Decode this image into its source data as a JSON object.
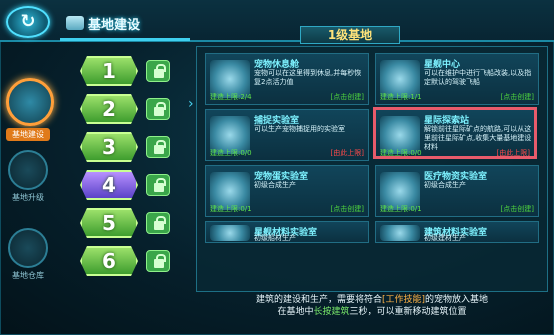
{
  "header": {
    "back_icon": "back-arrow-icon",
    "title": "基地建设",
    "level_tab": "1级基地"
  },
  "categories": [
    {
      "label": "基地建设",
      "icon": "base-building-icon",
      "active": true
    },
    {
      "label": "基地升级",
      "icon": "base-upgrade-icon",
      "active": false
    },
    {
      "label": "基地仓库",
      "icon": "warehouse-box-icon",
      "active": false
    }
  ],
  "levels": [
    {
      "num": "1",
      "color": "green"
    },
    {
      "num": "2",
      "color": "green"
    },
    {
      "num": "3",
      "color": "green"
    },
    {
      "num": "4",
      "color": "purple"
    },
    {
      "num": "5",
      "color": "green"
    },
    {
      "num": "6",
      "color": "green"
    }
  ],
  "buildings": [
    {
      "name": "宠物休息舱",
      "desc": "宠物可以在这里得到休息,并每秒恢复2点活力值",
      "count": "建造上限:2/4",
      "status": "[点击创建]",
      "status_color": "green"
    },
    {
      "name": "星舰中心",
      "desc": "可以在维护中进行飞船改装,以及指定默认的驾驶飞船",
      "count": "建造上限:1/1",
      "status": "[点击创建]",
      "status_color": "green"
    },
    {
      "name": "捕捉实验室",
      "desc": "可以生产宠物捕捉用的实验室",
      "count": "建造上限:0/0",
      "status": "[由此上限]",
      "status_color": "red"
    },
    {
      "name": "星际探索站",
      "desc": "解锁前往星际矿点的航路,可以从这里前往星际矿点,收集大量基地建设材料",
      "count": "建造上限:0/0",
      "status": "[由此上限]",
      "status_color": "red"
    },
    {
      "name": "宠物蛋实验室",
      "desc": "初级合成生产",
      "count": "建造上限:0/1",
      "status": "[点击创建]",
      "status_color": "green"
    },
    {
      "name": "医疗物资实验室",
      "desc": "初级合成生产",
      "count": "建造上限:0/1",
      "status": "[点击创建]",
      "status_color": "green"
    },
    {
      "name": "星舰材料实验室",
      "desc": "初级船材生产",
      "count": "",
      "status": "",
      "status_color": "green"
    },
    {
      "name": "建筑材料实验室",
      "desc": "初级建材生产",
      "count": "",
      "status": "",
      "status_color": "green"
    }
  ],
  "message": {
    "line1_a": "建筑的建设和生产，需要将符合",
    "line1_hl": "[工作技能]",
    "line1_b": "的宠物放入基地",
    "line2_a": "在基地中",
    "line2_hl": "长按建筑",
    "line2_b": "三秒，可以重新移动建筑位置"
  },
  "colors": {
    "accent": "#3fd0ef",
    "badge_green": "#6cc24a",
    "badge_purple": "#8a6cf0",
    "selected_border": "#e85b6b",
    "status_green": "#4fd63e",
    "status_red": "#ff4a4a"
  }
}
